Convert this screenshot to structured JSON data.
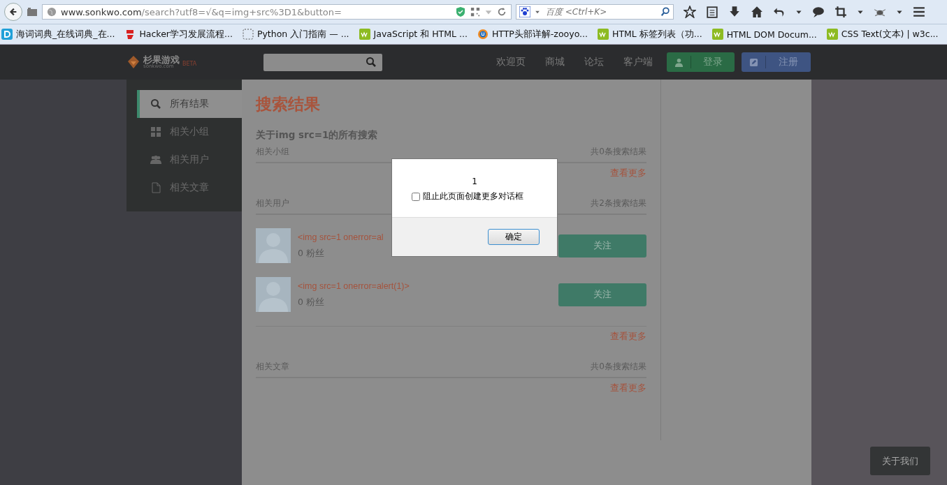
{
  "browser": {
    "url_host": "www.sonkwo.com",
    "url_path": "/search?utf8=√&q=img+src%3D1&button=",
    "search_placeholder": "百度 <Ctrl+K>",
    "bookmarks": [
      "海词词典_在线词典_在...",
      "Hacker学习发展流程...",
      "Python 入门指南 — ...",
      "JavaScript 和 HTML ...",
      "HTTP头部详解-zooyo...",
      "HTML 标签列表（功...",
      "HTML DOM Docum...",
      "CSS Text(文本) | w3c..."
    ]
  },
  "site": {
    "logo_text": "杉果游戏",
    "logo_domain": "sonkwo.com",
    "logo_badge": "BETA",
    "nav": [
      "欢迎页",
      "商城",
      "论坛",
      "客户端"
    ],
    "login": "登录",
    "register": "注册"
  },
  "sidebar": {
    "items": [
      {
        "label": "所有结果",
        "selected": true
      },
      {
        "label": "相关小组",
        "selected": false
      },
      {
        "label": "相关用户",
        "selected": false
      },
      {
        "label": "相关文章",
        "selected": false
      }
    ]
  },
  "content": {
    "title": "搜索结果",
    "query_heading": "关于img src=1的所有搜索",
    "sections": [
      {
        "label": "相关小组",
        "count": "共0条搜索结果",
        "more": "查看更多"
      },
      {
        "label": "相关用户",
        "count": "共2条搜索结果",
        "more": "查看更多",
        "users": [
          {
            "name": "<img src=1 onerror=al",
            "fans": "0 粉丝",
            "follow": "关注"
          },
          {
            "name": "<img src=1 onerror=alert(1)>",
            "fans": "0 粉丝",
            "follow": "关注"
          }
        ]
      },
      {
        "label": "相关文章",
        "count": "共0条搜索结果",
        "more": "查看更多"
      }
    ]
  },
  "dialog": {
    "message": "1",
    "checkbox_label": "阻止此页面创建更多对话框",
    "checked": false,
    "button": "确定"
  },
  "footer_button": "关于我们"
}
